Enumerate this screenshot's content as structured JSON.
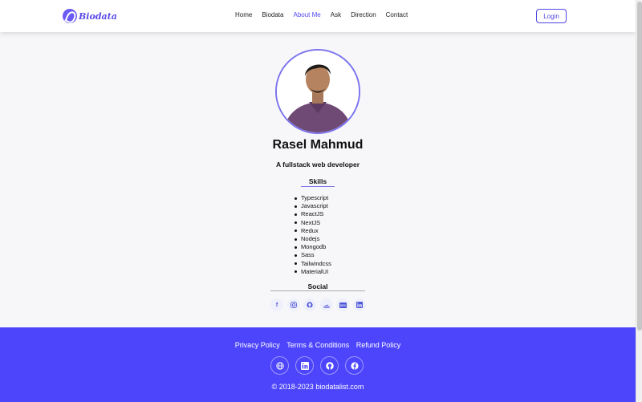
{
  "brand": {
    "name": "Biodata",
    "accent": "#4d45fb"
  },
  "nav": {
    "items": [
      {
        "label": "Home"
      },
      {
        "label": "Biodata"
      },
      {
        "label": "About Me"
      },
      {
        "label": "Ask"
      },
      {
        "label": "Direction"
      },
      {
        "label": "Contact"
      }
    ],
    "active_label": "About Me",
    "login_label": "Login"
  },
  "profile": {
    "name": "Rasel Mahmud",
    "tagline": "A fullstack web developer",
    "skills_title": "Skills",
    "skills": [
      "Typescript",
      "Javascript",
      "ReactJS",
      "NextJS",
      "Redux",
      "Nodejs",
      "Mongodb",
      "Sass",
      "Tailwindcss",
      "MaterialUI"
    ],
    "social_title": "Social",
    "social_icons": [
      "facebook-icon",
      "instagram-icon",
      "github-icon",
      "stackoverflow-icon",
      "dev-icon",
      "linkedin-icon"
    ]
  },
  "footer": {
    "links": [
      "Privacy Policy",
      "Terms & Conditions",
      "Refund Policy"
    ],
    "icons": [
      "globe-icon",
      "linkedin-icon",
      "github-icon",
      "facebook-icon"
    ],
    "copyright": "© 2018-2023 biodatalist.com"
  }
}
